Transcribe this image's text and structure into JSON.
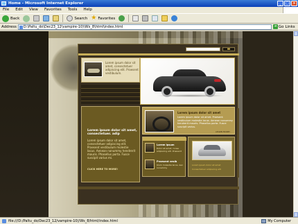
{
  "window": {
    "title": "Home - Microsoft Internet Explorer",
    "controls": [
      "_",
      "□",
      "×"
    ]
  },
  "menu": [
    "File",
    "Edit",
    "View",
    "Favorites",
    "Tools",
    "Help"
  ],
  "toolbar": {
    "back": "Back",
    "search": "Search",
    "favorites": "Favorites"
  },
  "address": {
    "label": "Address",
    "value": "D:\\Paltu_do\\Dec23_12\\vampire-10)\\Ws_8\\html\\index.html",
    "go": "Go",
    "links": "Links"
  },
  "site": {
    "intro_text": "Lorem ipsum dolor sit amet, consectetuer adipiscing elit. Praesent vestibulum.",
    "feature_title": "Lorem ipsum dolor sit amet, consectetuer. adip",
    "feature_text": "Lorem ipsum dolor sit amet, consectetuer adipiscing elit. Praesent vestibulum molestie lacus. Aenean nonummy hendrerit mauris. Phasellus porta. Fusce suscipit varius mi.",
    "feature_link": "CLICK HERE TO MORE!",
    "mid_title": "Lorem ipsum dolor sit amet",
    "mid_text": "Lorem ipsum dolor sit amet. Praesent vestibulum molestie lacus. Aenean nonummy hendrerit mauris. Phasellus porta. Fusce suscipit varius.",
    "mid_link": "LEARN MORE!",
    "small1_title": "Lorem ipsum",
    "small1_text": "Dolor sit amet, conse adipiscing elit. Praesent",
    "small2_title": "Praesent vesib",
    "small2_text": "Ulum molestie lacus. Aen nonummy",
    "silver_line1": "Lorem ipsum dolor sit amet",
    "silver_line2": "Consectetuer adipiscing elit"
  },
  "status": {
    "text": "file:///D:/Paltu_do/Dec23_12/vampire-10)/Ws_8/html/index.html",
    "zone": "My Computer"
  }
}
